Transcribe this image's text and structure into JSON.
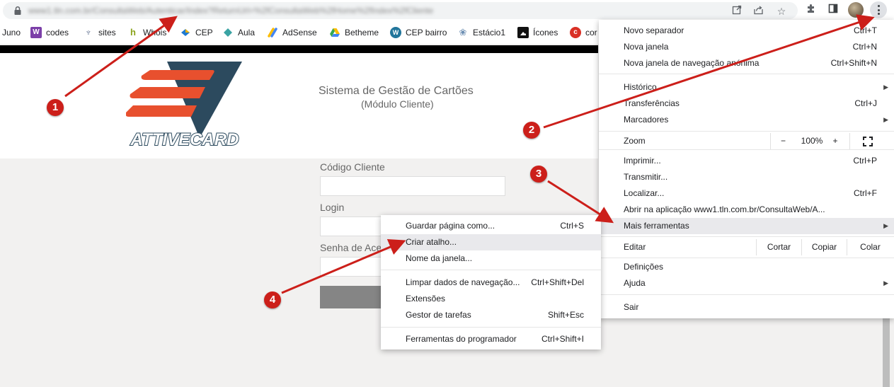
{
  "browser": {
    "url": "www1.tln.com.br/ConsultaWeb/Autenticar/Index?ReturnUrl=%2fConsultaWeb%2fHome%2fIndex%2fCliente",
    "icons": [
      "open-external-icon",
      "share-icon",
      "star-icon",
      "extensions-icon",
      "sidepanel-icon",
      "kebab-menu-icon"
    ]
  },
  "bookmarks": [
    {
      "label": "Juno",
      "icon": "juno-favicon",
      "color": "#ffffff"
    },
    {
      "label": "codes",
      "icon": "w-favicon",
      "color": "#7b3fa8"
    },
    {
      "label": "sites",
      "icon": "sites-favicon",
      "color": "#5b6b8c"
    },
    {
      "label": "Whois",
      "icon": "whois-favicon",
      "color": "#8aa31b"
    },
    {
      "label": "CEP",
      "icon": "cep-favicon",
      "color": "#1f7ad1"
    },
    {
      "label": "Aula",
      "icon": "aula-favicon",
      "color": "#3aa3a3"
    },
    {
      "label": "AdSense",
      "icon": "adsense-favicon",
      "color": "#fbbc04"
    },
    {
      "label": "Betheme",
      "icon": "drive-favicon",
      "color": "#34a853"
    },
    {
      "label": "CEP bairro",
      "icon": "wordpress-favicon",
      "color": "#21759b"
    },
    {
      "label": "Estácio1",
      "icon": "estacio-favicon",
      "color": "#6d8fb3"
    },
    {
      "label": "Ícones",
      "icon": "icones-favicon",
      "color": "#111111"
    },
    {
      "label": "cor",
      "icon": "cor-favicon",
      "color": "#d93025"
    }
  ],
  "page": {
    "system_title": "Sistema de Gestão de Cartões",
    "system_subtitle": "(Módulo Cliente)",
    "logo_text": "ATTIVECARD",
    "fields": [
      {
        "label": "Código Cliente",
        "value": ""
      },
      {
        "label": "Login",
        "value": ""
      },
      {
        "label": "Senha de Ace",
        "value": ""
      }
    ]
  },
  "main_menu": {
    "new_tab": {
      "label": "Novo separador",
      "shortcut": "Ctrl+T"
    },
    "new_window": {
      "label": "Nova janela",
      "shortcut": "Ctrl+N"
    },
    "incognito": {
      "label": "Nova janela de navegação anónima",
      "shortcut": "Ctrl+Shift+N"
    },
    "history": {
      "label": "Histórico"
    },
    "downloads": {
      "label": "Transferências",
      "shortcut": "Ctrl+J"
    },
    "bookmarks": {
      "label": "Marcadores"
    },
    "zoom": {
      "label": "Zoom",
      "minus": "−",
      "value": "100%",
      "plus": "+"
    },
    "print": {
      "label": "Imprimir...",
      "shortcut": "Ctrl+P"
    },
    "cast": {
      "label": "Transmitir..."
    },
    "find": {
      "label": "Localizar...",
      "shortcut": "Ctrl+F"
    },
    "open_in_app": {
      "label": "Abrir na aplicação www1.tln.com.br/ConsultaWeb/A..."
    },
    "more_tools": {
      "label": "Mais ferramentas"
    },
    "edit": {
      "label": "Editar",
      "cut": "Cortar",
      "copy": "Copiar",
      "paste": "Colar"
    },
    "settings": {
      "label": "Definições"
    },
    "help": {
      "label": "Ajuda"
    },
    "exit": {
      "label": "Sair"
    }
  },
  "submenu": {
    "save_page": {
      "label": "Guardar página como...",
      "shortcut": "Ctrl+S"
    },
    "create_shortcut": {
      "label": "Criar atalho..."
    },
    "name_window": {
      "label": "Nome da janela..."
    },
    "clear_data": {
      "label": "Limpar dados de navegação...",
      "shortcut": "Ctrl+Shift+Del"
    },
    "extensions": {
      "label": "Extensões"
    },
    "task_manager": {
      "label": "Gestor de tarefas",
      "shortcut": "Shift+Esc"
    },
    "dev_tools": {
      "label": "Ferramentas do programador",
      "shortcut": "Ctrl+Shift+I"
    }
  },
  "callouts": [
    "1",
    "2",
    "3",
    "4"
  ],
  "colors": {
    "callout_red": "#cc1f1a",
    "logo_orange": "#e8502e",
    "logo_navy": "#2c4a5e",
    "highlight": "#e9e9ec"
  }
}
